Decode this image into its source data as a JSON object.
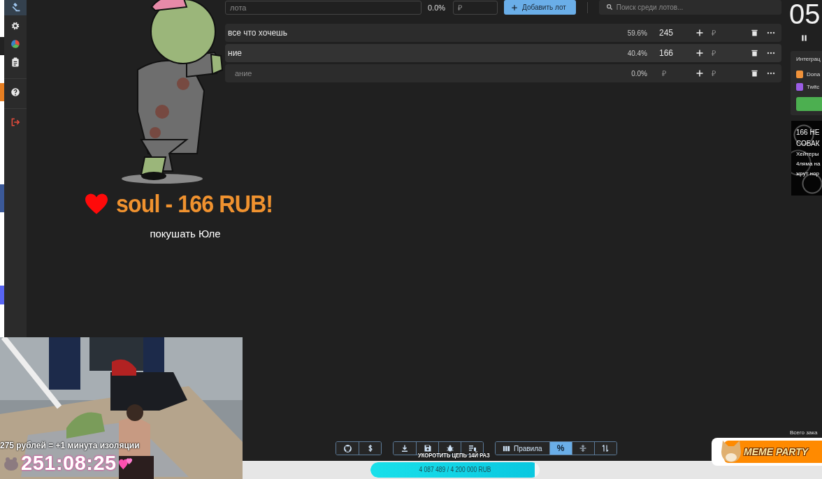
{
  "sidebar": {
    "items": [
      {
        "selected": true
      },
      {
        "selected": false
      },
      {
        "selected": false
      },
      {
        "selected": false
      },
      {
        "selected": false
      },
      {
        "selected": false
      }
    ]
  },
  "new_lot": {
    "name_placeholder": "лота",
    "percent": "0.0%",
    "amount_placeholder": "₽",
    "add_button": "Добавить лот"
  },
  "search": {
    "placeholder": "Поиск среди лотов..."
  },
  "lots": [
    {
      "name": "все что хочешь",
      "percent": "59.6%",
      "amount": "245",
      "add_placeholder": "₽"
    },
    {
      "name": "ние",
      "percent": "40.4%",
      "amount": "166",
      "add_placeholder": "₽"
    },
    {
      "name_placeholder": "ание",
      "percent": "0.0%",
      "amount_placeholder": "₽",
      "add_placeholder": "₽"
    }
  ],
  "timer": {
    "value": "05"
  },
  "integrations": {
    "title": "Интеграц",
    "items": [
      {
        "label": "Dona",
        "color": "#f0923a"
      },
      {
        "label": "Twitc",
        "color": "#9b5de5"
      }
    ]
  },
  "promo_card": {
    "lines": [
      "166 НЕ",
      "СОБАК",
      "Хейтеры",
      "4ляма на",
      "жрут нор"
    ]
  },
  "donation_alert": {
    "headline": "soul - 166 RUB!",
    "message": "покушать Юле"
  },
  "webcam": {
    "kind": "picture",
    "caption": "275 рублей = +1 минута изоляции",
    "timer": "251:08:25"
  },
  "toolbar": {
    "groups": [
      [
        {
          "selected": false
        },
        {
          "selected": false
        }
      ],
      [
        {
          "selected": false
        },
        {
          "selected": false
        },
        {
          "selected": false
        },
        {
          "selected": false
        }
      ],
      [
        {
          "label": "Правила",
          "selected": false
        },
        {
          "label": "%",
          "selected": true
        },
        {
          "selected": false
        },
        {
          "selected": false
        }
      ]
    ]
  },
  "goal": {
    "title": "УКОРОТИТЬ ЦЕПЬ 14Й РАЗ",
    "reading": "4 087 489 / 4 200 000 RUB",
    "level": 0.97
  },
  "total_label": "Всего зака",
  "logo": {
    "text": "MEME PARTY"
  }
}
